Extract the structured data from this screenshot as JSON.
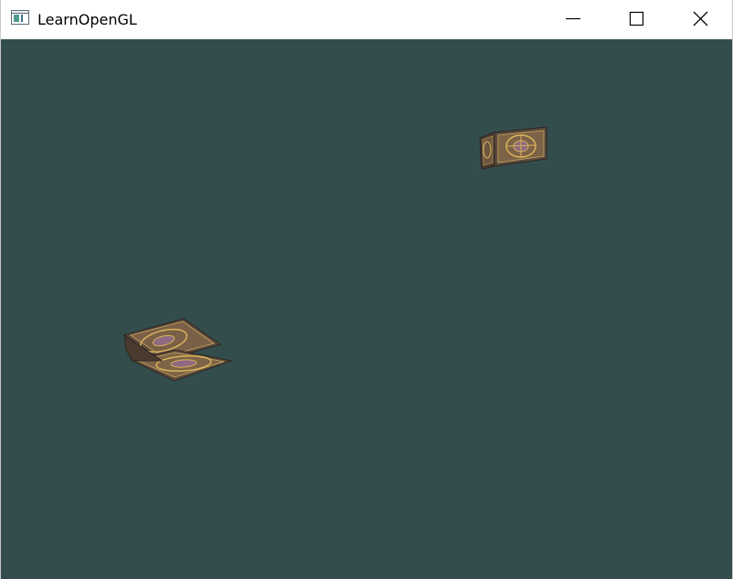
{
  "window": {
    "title": "LearnOpenGL",
    "icon": "app-window-icon",
    "controls": {
      "minimize": "minimize-icon",
      "maximize": "maximize-icon",
      "close": "close-icon"
    }
  },
  "viewport": {
    "clear_color": "#334d4d",
    "objects": [
      {
        "name": "textured-cube",
        "texture": "container"
      },
      {
        "name": "textured-cube",
        "texture": "container"
      }
    ]
  }
}
